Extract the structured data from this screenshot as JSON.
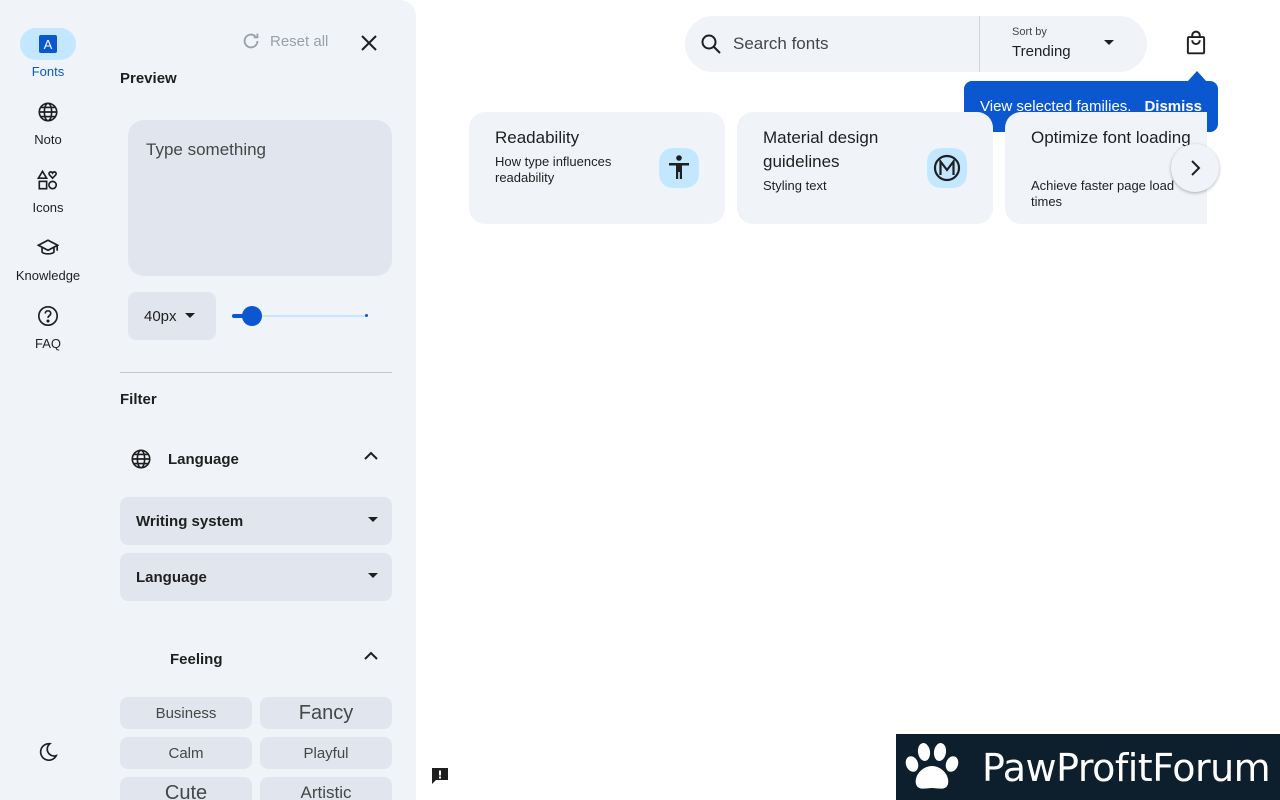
{
  "nav_rail": {
    "items": [
      {
        "label": "Fonts",
        "icon": "fonts-icon",
        "active": true
      },
      {
        "label": "Noto",
        "icon": "globe-icon",
        "active": false
      },
      {
        "label": "Icons",
        "icon": "shapes-icon",
        "active": false
      },
      {
        "label": "Knowledge",
        "icon": "graduation-cap-icon",
        "active": false
      },
      {
        "label": "FAQ",
        "icon": "help-circle-icon",
        "active": false
      }
    ],
    "theme_toggle_icon": "dark-mode-moon-icon"
  },
  "filter_panel": {
    "reset_label": "Reset all",
    "preview": {
      "title": "Preview",
      "placeholder": "Type something",
      "size_value": "40px",
      "size_slider_fraction": 0.12
    },
    "filter": {
      "title": "Filter",
      "language_section": {
        "label": "Language",
        "expanded": true,
        "writing_system_label": "Writing system",
        "language_label": "Language"
      },
      "feeling_section": {
        "label": "Feeling",
        "expanded": true,
        "chips": [
          "Business",
          "Fancy",
          "Calm",
          "Playful",
          "Cute",
          "Artistic"
        ]
      }
    }
  },
  "search": {
    "placeholder": "Search fonts",
    "sort_caption": "Sort by",
    "sort_value": "Trending"
  },
  "tooltip": {
    "text": "View selected families.",
    "dismiss_label": "Dismiss"
  },
  "cards": [
    {
      "title": "Readability",
      "description": "How type influences readability",
      "icon": "accessibility-icon"
    },
    {
      "title": "Material design guidelines",
      "description": "Styling text",
      "icon": "material-logo-icon"
    },
    {
      "title": "Optimize font loading",
      "description": "Achieve faster page load times",
      "icon": "speed-icon"
    }
  ],
  "watermark": {
    "text": "PawProfitForum"
  },
  "colors": {
    "accent": "#0b57d0",
    "surface": "#f0f4f9",
    "chip_surface": "#e1e6ee",
    "active_pill": "#c2e7ff",
    "card_icon_bg": "#c2e7ff"
  }
}
